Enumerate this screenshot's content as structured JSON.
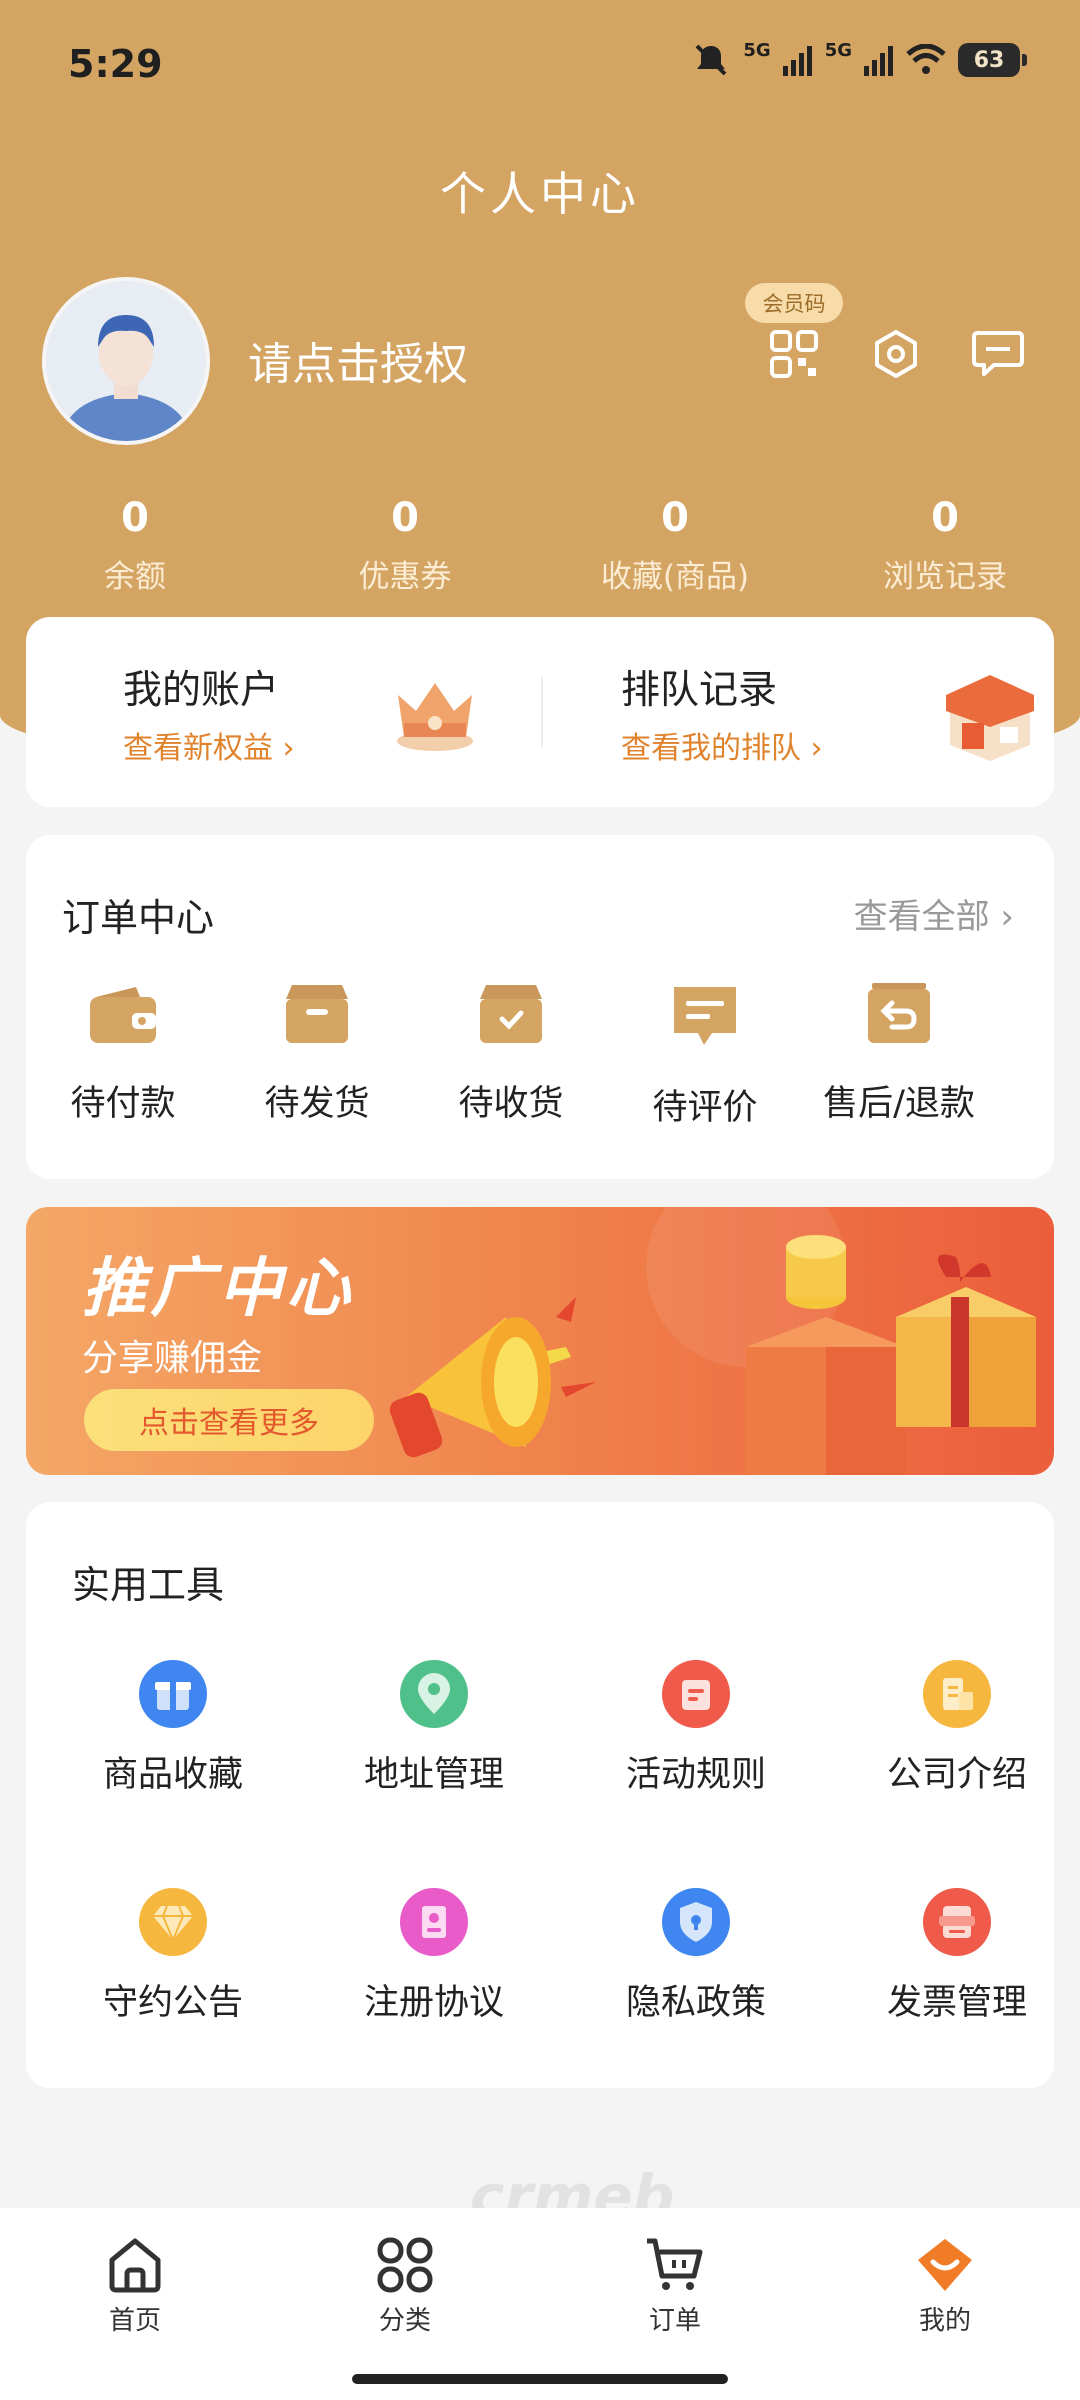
{
  "status_bar": {
    "time": "5:29",
    "network1": "5G",
    "network2": "5G",
    "battery": "63"
  },
  "header": {
    "title": "个人中心",
    "username": "请点击授权",
    "member_code_label": "会员码"
  },
  "stats": [
    {
      "value": "0",
      "label": "余额"
    },
    {
      "value": "0",
      "label": "优惠券"
    },
    {
      "value": "0",
      "label": "收藏(商品)"
    },
    {
      "value": "0",
      "label": "浏览记录"
    }
  ],
  "account_card": {
    "left": {
      "title": "我的账户",
      "link": "查看新权益 ›"
    },
    "right": {
      "title": "排队记录",
      "link": "查看我的排队 ›"
    }
  },
  "orders": {
    "title": "订单中心",
    "view_all": "查看全部 ›",
    "items": [
      {
        "label": "待付款",
        "icon": "wallet-icon"
      },
      {
        "label": "待发货",
        "icon": "box-icon"
      },
      {
        "label": "待收货",
        "icon": "received-box-icon"
      },
      {
        "label": "待评价",
        "icon": "comment-icon"
      },
      {
        "label": "售后/退款",
        "icon": "refund-icon"
      }
    ]
  },
  "banner": {
    "title": "推广中心",
    "subtitle": "分享赚佣金",
    "button": "点击查看更多"
  },
  "tools": {
    "title": "实用工具",
    "items": [
      {
        "label": "商品收藏",
        "icon": "gift-icon",
        "color": "#3f86f0"
      },
      {
        "label": "地址管理",
        "icon": "location-icon",
        "color": "#4fc08a"
      },
      {
        "label": "活动规则",
        "icon": "document-icon",
        "color": "#ef5a4a"
      },
      {
        "label": "公司介绍",
        "icon": "building-icon",
        "color": "#f5b73d"
      },
      {
        "label": "守约公告",
        "icon": "diamond-icon",
        "color": "#f5b73d"
      },
      {
        "label": "注册协议",
        "icon": "id-card-icon",
        "color": "#e95bc8"
      },
      {
        "label": "隐私政策",
        "icon": "shield-lock-icon",
        "color": "#3f86f0"
      },
      {
        "label": "发票管理",
        "icon": "invoice-icon",
        "color": "#ef5a4a"
      }
    ]
  },
  "watermark": "crmeb",
  "tabbar": [
    {
      "label": "首页",
      "icon": "home-icon"
    },
    {
      "label": "分类",
      "icon": "category-icon"
    },
    {
      "label": "订单",
      "icon": "cart-icon"
    },
    {
      "label": "我的",
      "icon": "profile-icon"
    }
  ],
  "colors": {
    "brand": "#d4a463",
    "accent": "#e0832c",
    "active_tab": "#f07c27"
  }
}
